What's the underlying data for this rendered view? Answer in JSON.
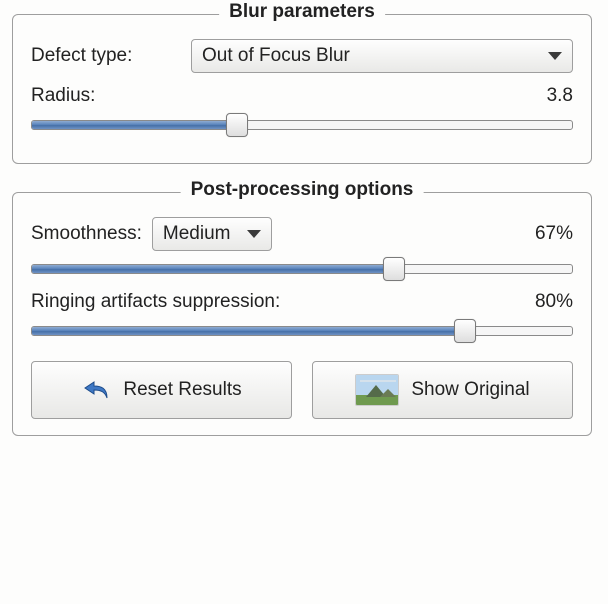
{
  "blur": {
    "title": "Blur parameters",
    "defect_label": "Defect type:",
    "defect_selected": "Out of Focus Blur",
    "radius_label": "Radius:",
    "radius_value": "3.8",
    "radius_percent": 38
  },
  "post": {
    "title": "Post-processing options",
    "smoothness_label": "Smoothness:",
    "smoothness_selected": "Medium",
    "smoothness_value": "67%",
    "smoothness_percent": 67,
    "ringing_label": "Ringing artifacts suppression:",
    "ringing_value": "80%",
    "ringing_percent": 80,
    "reset_label": "Reset Results",
    "show_label": "Show Original"
  }
}
